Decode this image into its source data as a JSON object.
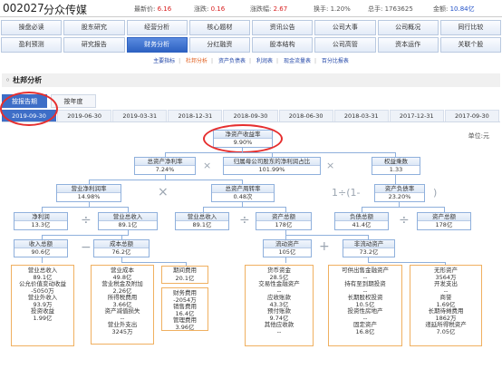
{
  "header": {
    "code": "002027",
    "name": "分众传媒",
    "quotes": [
      {
        "label": "最新价:",
        "value": "6.16"
      },
      {
        "label": "涨跌:",
        "value": "0.16"
      },
      {
        "label": "涨跌幅:",
        "value": "2.67"
      },
      {
        "label": "换手:",
        "value": "1.20%"
      },
      {
        "label": "总手:",
        "value": "1763625"
      },
      {
        "label": "金额:",
        "value": "10.84亿"
      }
    ]
  },
  "nav": {
    "row1": [
      "操盘必读",
      "股东研究",
      "经营分析",
      "核心题材",
      "资讯公告",
      "公司大事",
      "公司概况",
      "同行比较"
    ],
    "row2": [
      "盈利预测",
      "研究报告",
      "财务分析",
      "分红融资",
      "股本结构",
      "公司高管",
      "资本运作",
      "关联个股"
    ],
    "active": "财务分析"
  },
  "subnav": [
    "主要指标",
    "杜邦分析",
    "资产负债表",
    "利润表",
    "现金流量表",
    "百分比报表"
  ],
  "subnav_active": "杜邦分析",
  "section_title": "杜邦分析",
  "period_tabs": [
    "按报告期",
    "按年度"
  ],
  "dates": [
    "2019-09-30",
    "2019-06-30",
    "2019-03-31",
    "2018-12-31",
    "2018-09-30",
    "2018-06-30",
    "2018-03-31",
    "2017-12-31",
    "2017-09-30"
  ],
  "unit": "单位:元",
  "tree": {
    "roe": {
      "label": "净资产收益率",
      "value": "9.90%"
    },
    "roa": {
      "label": "总资产净利率",
      "value": "7.24%"
    },
    "parent_ratio": {
      "label": "归属母公司股东的净利润占比",
      "value": "101.99%"
    },
    "equity_mult": {
      "label": "权益乘数",
      "value": "1.33"
    },
    "net_margin": {
      "label": "营业净利润率",
      "value": "14.98%"
    },
    "asset_turnover": {
      "label": "总资产周转率",
      "value": "0.48次"
    },
    "debt_ratio": {
      "label": "资产负债率",
      "value": "23.20%"
    },
    "net_profit": {
      "label": "净利润",
      "value": "13.3亿"
    },
    "revenue_a": {
      "label": "营业总收入",
      "value": "89.1亿"
    },
    "revenue_b": {
      "label": "营业总收入",
      "value": "89.1亿"
    },
    "total_assets_a": {
      "label": "资产总额",
      "value": "178亿"
    },
    "liabilities": {
      "label": "负债总额",
      "value": "41.4亿"
    },
    "total_assets_b": {
      "label": "资产总额",
      "value": "178亿"
    },
    "total_income": {
      "label": "收入总额",
      "value": "90.6亿"
    },
    "total_cost": {
      "label": "成本总额",
      "value": "76.2亿"
    },
    "current_assets": {
      "label": "流动资产",
      "value": "105亿"
    },
    "noncurrent_assets": {
      "label": "非流动资产",
      "value": "73.2亿"
    },
    "period_expense": {
      "label": "期间费用",
      "value": "20.1亿"
    },
    "one_minus": "1÷(1-",
    "close_paren": ")"
  },
  "details": {
    "income": [
      {
        "name": "营业总收入",
        "value": "89.1亿"
      },
      {
        "name": "公允价值变动收益",
        "value": "-5050万"
      },
      {
        "name": "营业外收入",
        "value": "93.9万"
      },
      {
        "name": "投资收益",
        "value": "1.99亿"
      }
    ],
    "cost": [
      {
        "name": "营业成本",
        "value": "49.8亿"
      },
      {
        "name": "营业税金及附加",
        "value": "2.26亿"
      },
      {
        "name": "所得税费用",
        "value": "3.66亿"
      },
      {
        "name": "资产减值损失",
        "value": "--"
      },
      {
        "name": "营业外支出",
        "value": "3245万"
      }
    ],
    "expense": [
      {
        "name": "财务费用",
        "value": "-2054万"
      },
      {
        "name": "销售费用",
        "value": "16.4亿"
      },
      {
        "name": "管理费用",
        "value": "3.96亿"
      }
    ],
    "current": [
      {
        "name": "货币资金",
        "value": "28.5亿"
      },
      {
        "name": "交易性金融资产",
        "value": "--"
      },
      {
        "name": "应收账款",
        "value": "43.3亿"
      },
      {
        "name": "预付账款",
        "value": "9.74亿"
      },
      {
        "name": "其他应收款",
        "value": "--"
      }
    ],
    "noncurrent_a": [
      {
        "name": "可供出售金融资产",
        "value": "--"
      },
      {
        "name": "持有至到期投资",
        "value": "--"
      },
      {
        "name": "长期股权投资",
        "value": "10.5亿"
      },
      {
        "name": "投资性房地产",
        "value": "--"
      },
      {
        "name": "固定资产",
        "value": "16.8亿"
      }
    ],
    "noncurrent_b": [
      {
        "name": "无形资产",
        "value": "3564万"
      },
      {
        "name": "开发支出",
        "value": "--"
      },
      {
        "name": "商誉",
        "value": "1.69亿"
      },
      {
        "name": "长期待摊费用",
        "value": "1862万"
      },
      {
        "name": "递延所得税资产",
        "value": "7.05亿"
      }
    ]
  },
  "colors": {
    "accent": "#3e6ec7",
    "price_up": "#d82020",
    "highlight": "#e62e2e",
    "node_border": "#8fb0dc",
    "detail_border": "#f0b060"
  }
}
